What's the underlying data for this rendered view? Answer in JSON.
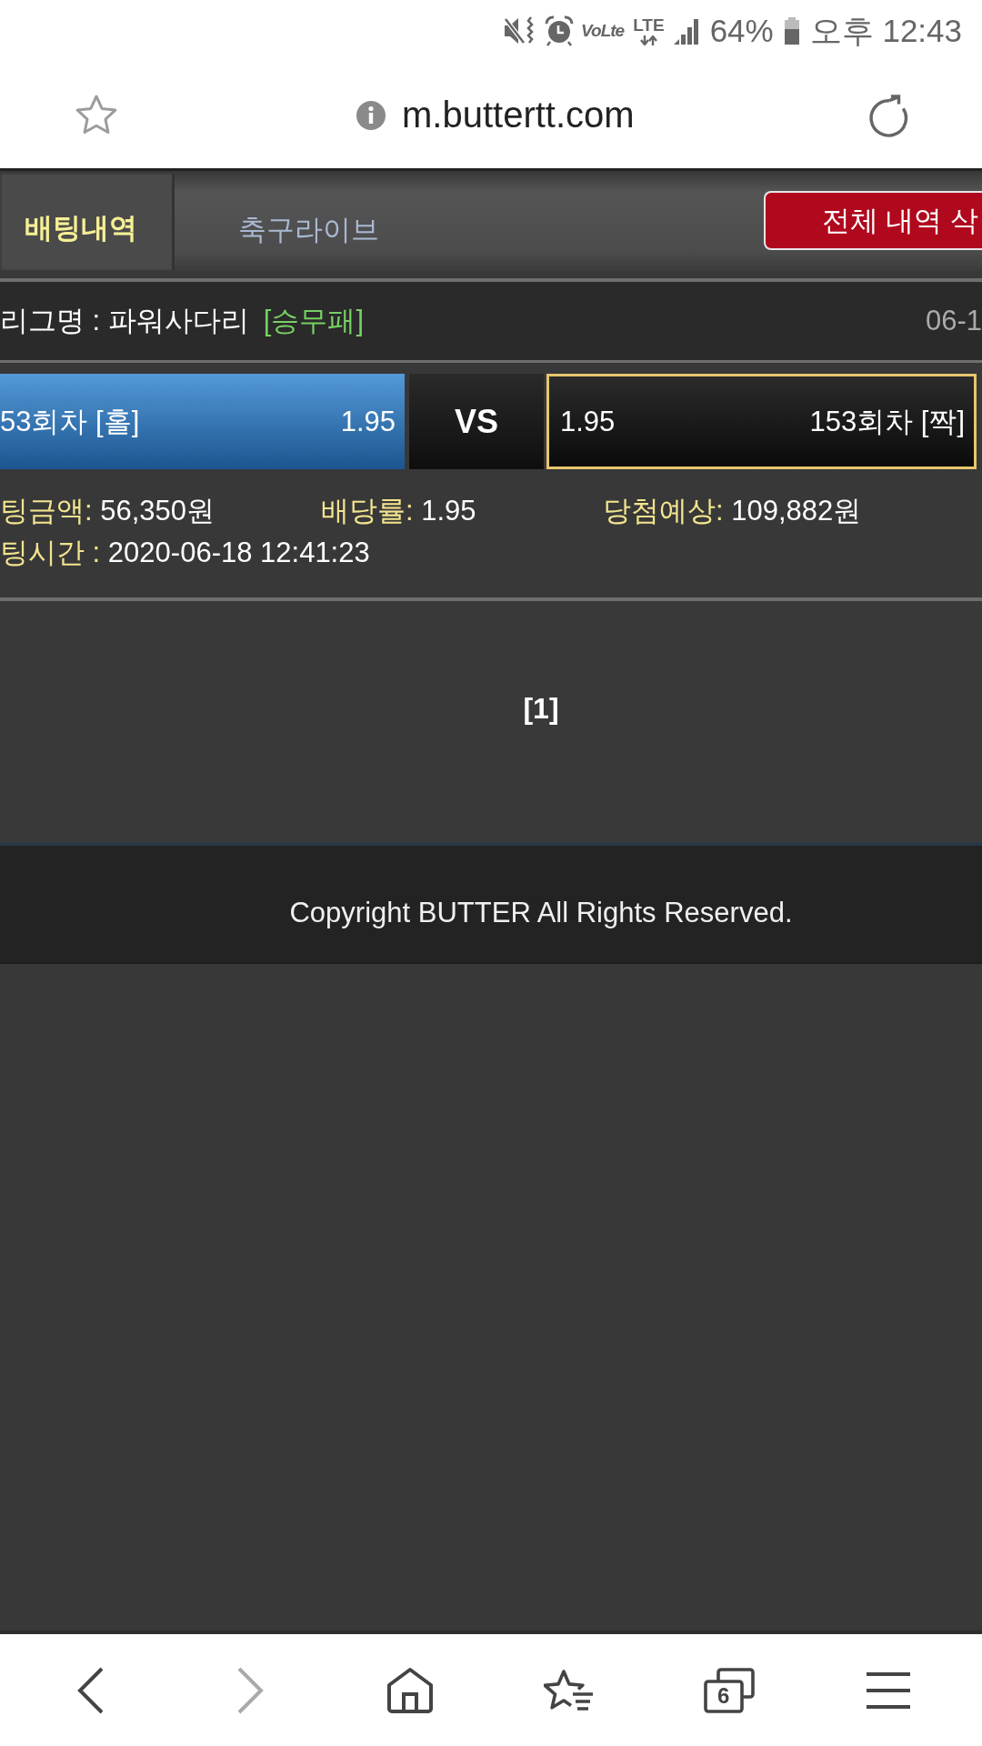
{
  "status_bar": {
    "volte": "VoLte",
    "network": "LTE",
    "battery": "64%",
    "time": "오후 12:43"
  },
  "address_bar": {
    "url": "m.buttertt.com"
  },
  "tabs": [
    {
      "label": "배팅내역",
      "selected": true
    },
    {
      "label": "축구라이브",
      "selected": false
    }
  ],
  "delete_button": "전체 내역 삭",
  "bet": {
    "league": "리그명 : 파워사다리",
    "game_type": "[승무패]",
    "date": "06-1",
    "picks": [
      {
        "kind": "home",
        "name": "53회차 [홀]",
        "odds": "1.95",
        "selected": true
      },
      {
        "kind": "away",
        "name": "153회차 [짝]",
        "odds": "1.95",
        "selected": false
      }
    ],
    "versus": "VS",
    "details": [
      {
        "label": "팅금액:",
        "value": "56,350원"
      },
      {
        "label": "배당률:",
        "value": "1.95"
      },
      {
        "label": "당첨예상:",
        "value": "109,882원"
      },
      {
        "label": "팅시간 :",
        "value": "2020-06-18 12:41:23"
      }
    ]
  },
  "pager": {
    "pages": [
      {
        "label": "[1]",
        "selected": true
      }
    ]
  },
  "footer": {
    "copyright": "Copyright BUTTER All Rights Reserved."
  },
  "bottom_nav": [
    {
      "kind": "back",
      "disabled": false
    },
    {
      "kind": "forward",
      "disabled": true
    },
    {
      "kind": "home",
      "disabled": false
    },
    {
      "kind": "bookmarks",
      "disabled": false
    },
    {
      "kind": "tabs",
      "count": "6",
      "disabled": false
    },
    {
      "kind": "menu",
      "disabled": false
    }
  ]
}
